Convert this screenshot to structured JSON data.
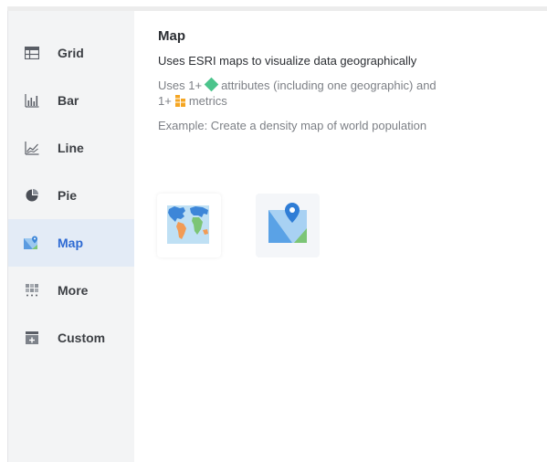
{
  "sidebar": {
    "items": [
      {
        "label": "Grid",
        "icon": "grid-icon"
      },
      {
        "label": "Bar",
        "icon": "bar-chart-icon"
      },
      {
        "label": "Line",
        "icon": "line-chart-icon"
      },
      {
        "label": "Pie",
        "icon": "pie-chart-icon"
      },
      {
        "label": "Map",
        "icon": "map-icon",
        "active": true
      },
      {
        "label": "More",
        "icon": "more-icon"
      },
      {
        "label": "Custom",
        "icon": "custom-icon"
      }
    ]
  },
  "detail": {
    "title": "Map",
    "description": "Uses ESRI maps to visualize data geographically",
    "req_prefix": "Uses 1+",
    "req_attributes": "attributes (including one geographic) and",
    "req_prefix2": "1+",
    "req_metrics": "metrics",
    "example": "Example: Create a density map of world population"
  },
  "options": [
    {
      "icon": "world-map-icon"
    },
    {
      "icon": "map-pin-icon"
    }
  ],
  "colors": {
    "accent": "#2e6ad3",
    "active_bg": "#e3ebf6",
    "attribute": "#4cc48c",
    "metric": "#f5a623"
  }
}
